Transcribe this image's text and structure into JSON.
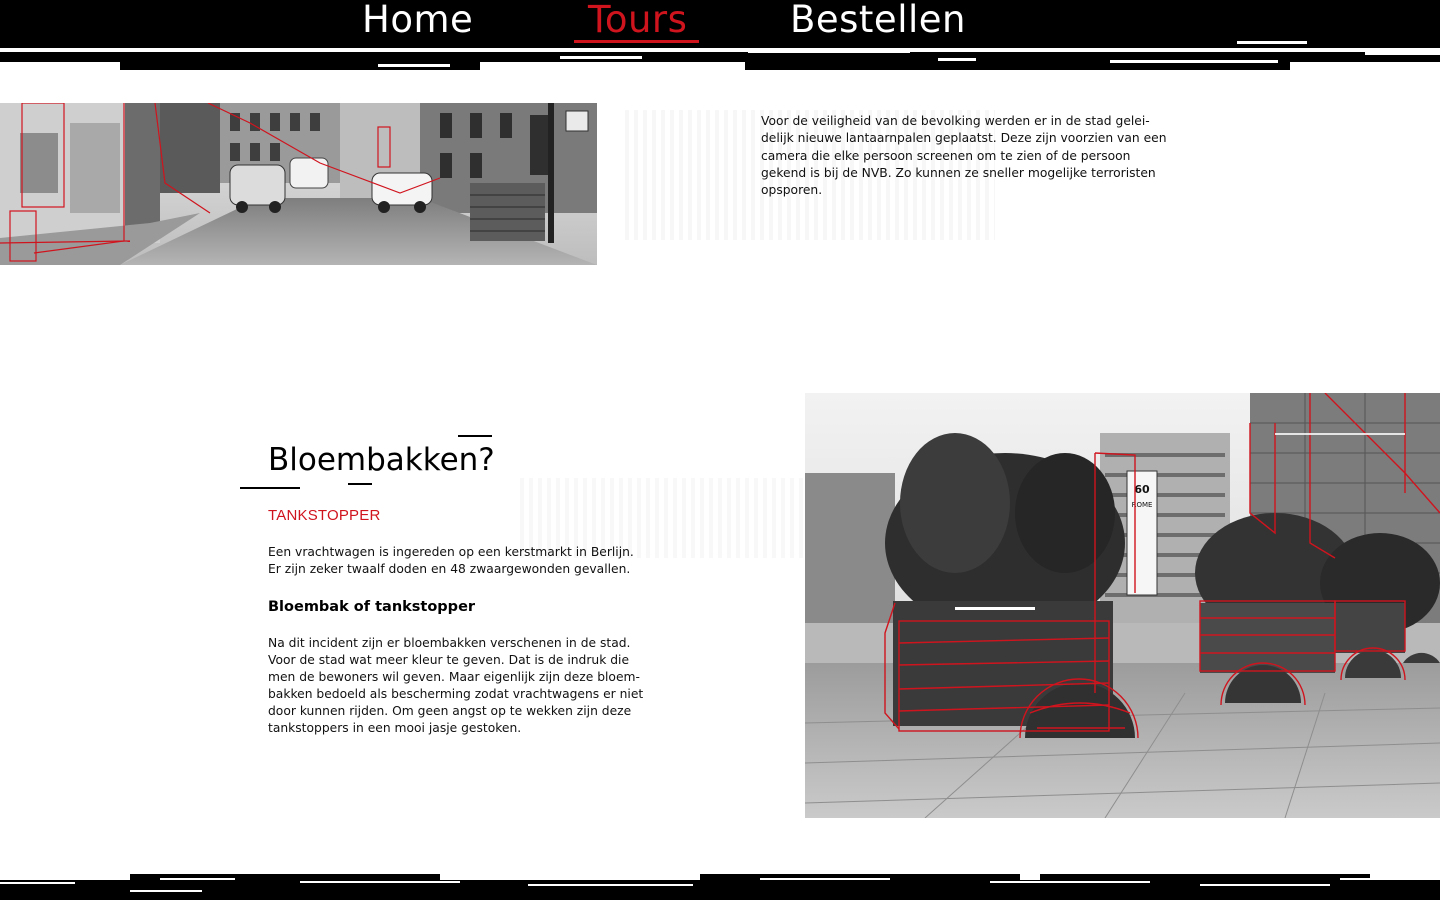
{
  "nav": {
    "items": [
      {
        "label": "Home",
        "active": false
      },
      {
        "label": "Tours",
        "active": true
      },
      {
        "label": "Bestellen",
        "active": false
      }
    ],
    "active_color": "#d0141e"
  },
  "intro": {
    "text": "Voor de veiligheid van de bevolking werden er in de stad gelei-\ndelijk nieuwe lantaarnpalen geplaatst. Deze zijn voorzien van een\ncamera die elke persoon screenen om te zien of de persoon\ngekend is bij de NVB. Zo kunnen ze sneller mogelijke terroristen\nopsporen."
  },
  "section": {
    "title": "Bloembakken?",
    "kicker": "TANKSTOPPER",
    "paragraph1": "Een vrachtwagen is ingereden op een kerstmarkt in Berlijn.\nEr zijn zeker twaalf doden en 48 zwaargewonden gevallen.",
    "subtitle": "Bloembak of tankstopper",
    "paragraph2": "Na dit incident zijn er bloembakken verschenen in de stad.\nVoor de stad wat meer kleur te geven. Dat is de indruk die\nmen de bewoners wil geven. Maar eigenlijk zijn deze bloem-\nbakken bedoeld als bescherming zodat vrachtwagens er niet\ndoor kunnen rijden. Om geen angst op te wekken zijn deze\ntankstoppers in een mooi jasje gestoken."
  },
  "images": {
    "street_photo": "street-camera-photo",
    "planter_photo": "planter-tankstopper-photo",
    "banner_text": "60 ROME"
  },
  "colors": {
    "accent": "#d0141e",
    "bar": "#000000",
    "background": "#ffffff"
  }
}
